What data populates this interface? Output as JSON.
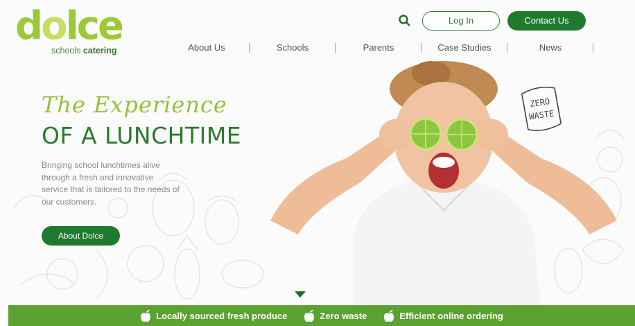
{
  "logo": {
    "word_prefix": "d",
    "word_o": "o",
    "word_suffix": "lce",
    "sub_regular": "schools ",
    "sub_bold": "catering"
  },
  "header": {
    "search_icon": "search-icon",
    "login_label": "Log In",
    "contact_label": "Contact Us"
  },
  "nav": {
    "items": [
      {
        "label": "About Us"
      },
      {
        "label": "Schools"
      },
      {
        "label": "Parents"
      },
      {
        "label": "Case Studies"
      },
      {
        "label": "News"
      }
    ]
  },
  "hero": {
    "script_title": "The Experience",
    "title": "OF A LUNCHTIME",
    "intro": "Bringing school lunchtimes alive through a fresh and innovative service that is tailored to the needs of our customers.",
    "button_label": "About Dolce",
    "badge_line1": "ZERO",
    "badge_line2": "WASTE"
  },
  "features": [
    {
      "icon": "apple-icon",
      "label": "Locally sourced fresh produce"
    },
    {
      "icon": "apple-icon",
      "label": "Zero waste"
    },
    {
      "icon": "apple-icon",
      "label": "Efficient online ordering"
    }
  ],
  "colors": {
    "brand_green": "#1f7a2e",
    "light_green": "#95c23d",
    "bar_green": "#5ba230"
  }
}
